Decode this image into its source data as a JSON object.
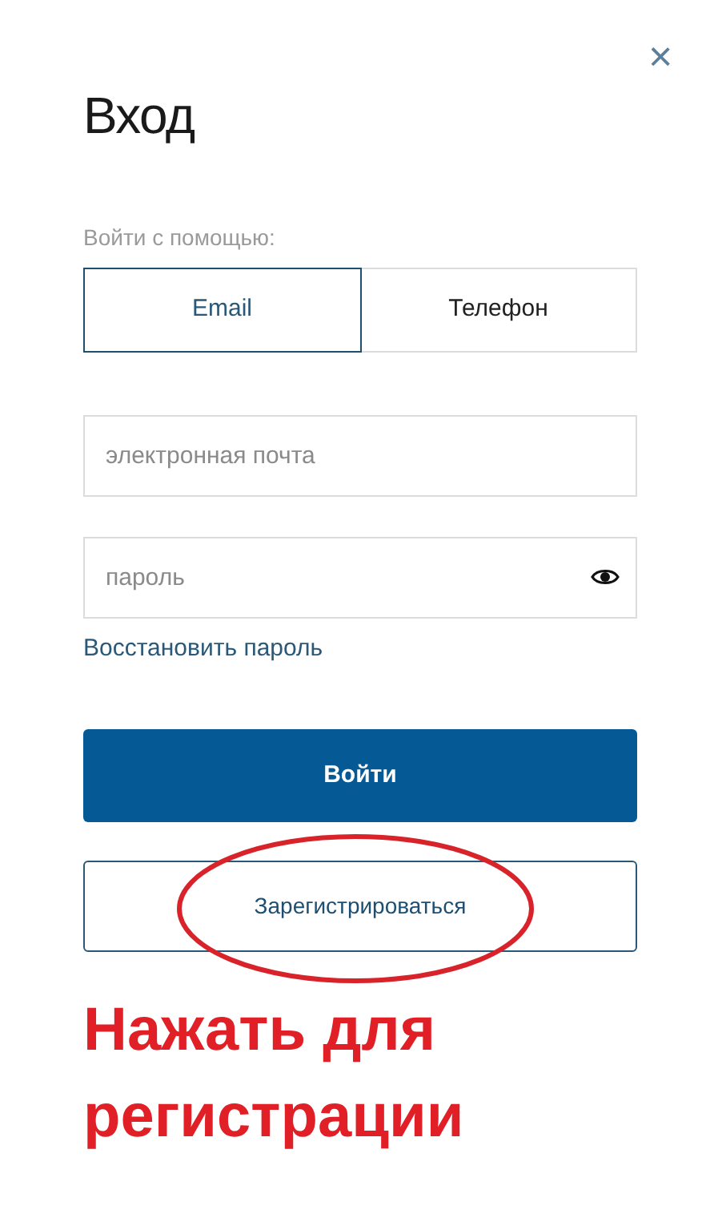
{
  "dialog": {
    "close": "×",
    "title": "Вход"
  },
  "login_with": {
    "label": "Войти с помощью:",
    "tabs": [
      {
        "label": "Email",
        "selected": true
      },
      {
        "label": "Телефон",
        "selected": false
      }
    ]
  },
  "fields": [
    {
      "kind": "text",
      "placeholder": "электронная почта"
    },
    {
      "kind": "password",
      "placeholder": "пароль"
    }
  ],
  "restore_link": "Восстановить пароль",
  "buttons": [
    {
      "kind": "primary",
      "label": "Войти"
    },
    {
      "kind": "outline",
      "label": "Зарегистрироваться",
      "circled": true
    }
  ],
  "annotation": {
    "lines": [
      "Нажать для",
      "регистрации"
    ]
  }
}
